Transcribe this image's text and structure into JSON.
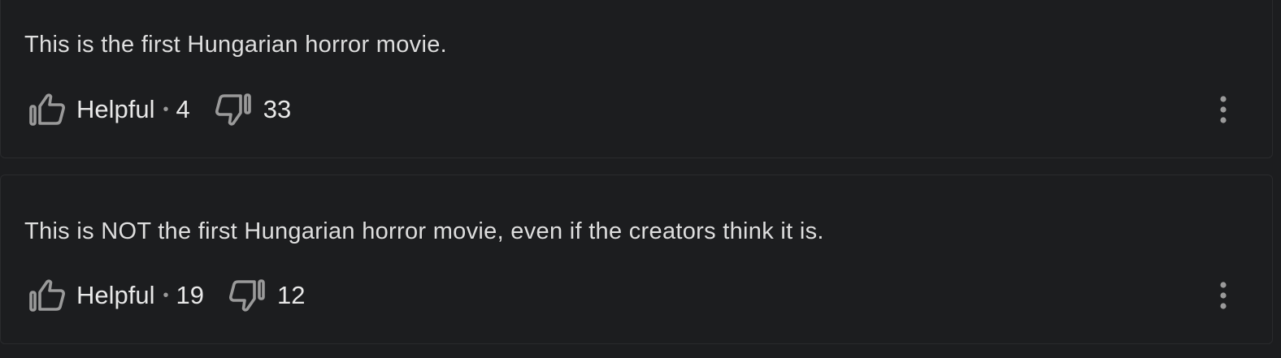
{
  "reviews": [
    {
      "text": "This is the first Hungarian horror movie.",
      "helpful_label": "Helpful",
      "separator": "•",
      "helpful_count": "4",
      "unhelpful_count": "33"
    },
    {
      "text": "This is NOT the first Hungarian horror movie, even if the creators think it is.",
      "helpful_label": "Helpful",
      "separator": "•",
      "helpful_count": "19",
      "unhelpful_count": "12"
    }
  ],
  "icons": {
    "helpful": "thumbs-up-icon",
    "unhelpful": "thumbs-down-icon",
    "more": "more-vertical-icon"
  },
  "colors": {
    "background": "#1c1d1f",
    "text": "#dedede",
    "icon": "#9a9a9a"
  }
}
